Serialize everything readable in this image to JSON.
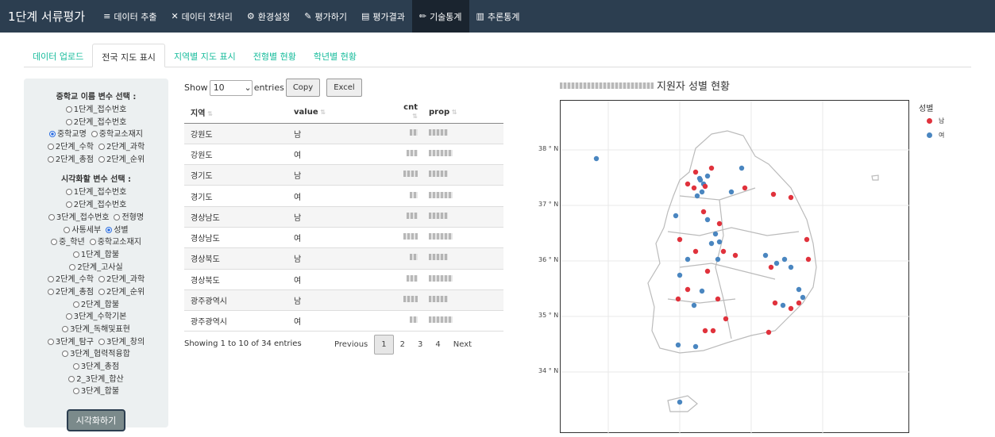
{
  "navbar": {
    "brand": "1단계 서류평가",
    "items": [
      {
        "label": "데이터 추출",
        "icon": "database-icon",
        "glyph": "≡"
      },
      {
        "label": "데이터 전처리",
        "icon": "tools-icon",
        "glyph": "✕"
      },
      {
        "label": "환경설정",
        "icon": "cogs-icon",
        "glyph": "⚙"
      },
      {
        "label": "평가하기",
        "icon": "edit-icon",
        "glyph": "✎"
      },
      {
        "label": "평가결과",
        "icon": "file-icon",
        "glyph": "▤"
      },
      {
        "label": "기술통계",
        "icon": "pencil-icon",
        "glyph": "✏"
      },
      {
        "label": "추론통계",
        "icon": "chart-icon",
        "glyph": "▥"
      }
    ],
    "active": "기술통계"
  },
  "tabs": {
    "items": [
      "데이터 업로드",
      "전국 지도 표시",
      "지역별 지도 표시",
      "전형별 현황",
      "학년별 현황"
    ],
    "active": "전국 지도 표시"
  },
  "sidebar": {
    "school_title": "중학교 이름 변수 선택 :",
    "school_rows": [
      [
        {
          "l": "1단계_접수번호",
          "on": false
        }
      ],
      [
        {
          "l": "2단계_접수번호",
          "on": false
        }
      ],
      [
        {
          "l": "중학교명",
          "on": true
        },
        {
          "l": "중학교소재지",
          "on": false
        }
      ],
      [
        {
          "l": "2단계_수학",
          "on": false
        },
        {
          "l": "2단계_과학",
          "on": false
        }
      ],
      [
        {
          "l": "2단계_총점",
          "on": false
        },
        {
          "l": "2단계_순위",
          "on": false
        }
      ]
    ],
    "viz_title": "시각화할 변수 선택 :",
    "viz_rows": [
      [
        {
          "l": "1단계_접수번호",
          "on": false
        }
      ],
      [
        {
          "l": "2단계_접수번호",
          "on": false
        }
      ],
      [
        {
          "l": "3단계_접수번호",
          "on": false
        },
        {
          "l": "전형명",
          "on": false
        }
      ],
      [
        {
          "l": "사통세부",
          "on": false
        },
        {
          "l": "성별",
          "on": true
        }
      ],
      [
        {
          "l": "중_학년",
          "on": false
        },
        {
          "l": "중학교소재지",
          "on": false
        }
      ],
      [
        {
          "l": "1단계_합불",
          "on": false
        }
      ],
      [
        {
          "l": "2단계_고사실",
          "on": false
        }
      ],
      [
        {
          "l": "2단계_수학",
          "on": false
        },
        {
          "l": "2단계_과학",
          "on": false
        }
      ],
      [
        {
          "l": "2단계_총점",
          "on": false
        },
        {
          "l": "2단계_순위",
          "on": false
        }
      ],
      [
        {
          "l": "2단계_합불",
          "on": false
        }
      ],
      [
        {
          "l": "3단계_수학기본",
          "on": false
        }
      ],
      [
        {
          "l": "3단계_독해및표현",
          "on": false
        }
      ],
      [
        {
          "l": "3단계_탐구",
          "on": false
        },
        {
          "l": "3단계_창의",
          "on": false
        }
      ],
      [
        {
          "l": "3단계_협력적융합",
          "on": false
        }
      ],
      [
        {
          "l": "3단계_총점",
          "on": false
        }
      ],
      [
        {
          "l": "2_3단계_합산",
          "on": false
        }
      ],
      [
        {
          "l": "3단계_합불",
          "on": false
        }
      ]
    ],
    "button": "시각화하기"
  },
  "table": {
    "show": "Show",
    "entries_value": "10",
    "entries": "entries",
    "copy": "Copy",
    "excel": "Excel",
    "headers": [
      "지역",
      "value",
      "cnt",
      "prop"
    ],
    "rows": [
      [
        "강원도",
        "남"
      ],
      [
        "강원도",
        "여"
      ],
      [
        "경기도",
        "남"
      ],
      [
        "경기도",
        "여"
      ],
      [
        "경상남도",
        "남"
      ],
      [
        "경상남도",
        "여"
      ],
      [
        "경상북도",
        "남"
      ],
      [
        "경상북도",
        "여"
      ],
      [
        "광주광역시",
        "남"
      ],
      [
        "광주광역시",
        "여"
      ]
    ],
    "info": "Showing 1 to 10 of 34 entries",
    "pager": {
      "previous": "Previous",
      "pages": [
        "1",
        "2",
        "3",
        "4"
      ],
      "current": "1",
      "next": "Next"
    }
  },
  "map": {
    "title": "지원자 성별 현황",
    "legend_title": "성별",
    "legend": [
      {
        "label": "남",
        "color": "#e0323c"
      },
      {
        "label": "여",
        "color": "#4a86c0"
      }
    ],
    "y_ticks": [
      "38 ° N",
      "37 ° N",
      "36 ° N",
      "35 ° N",
      "34 ° N"
    ]
  }
}
